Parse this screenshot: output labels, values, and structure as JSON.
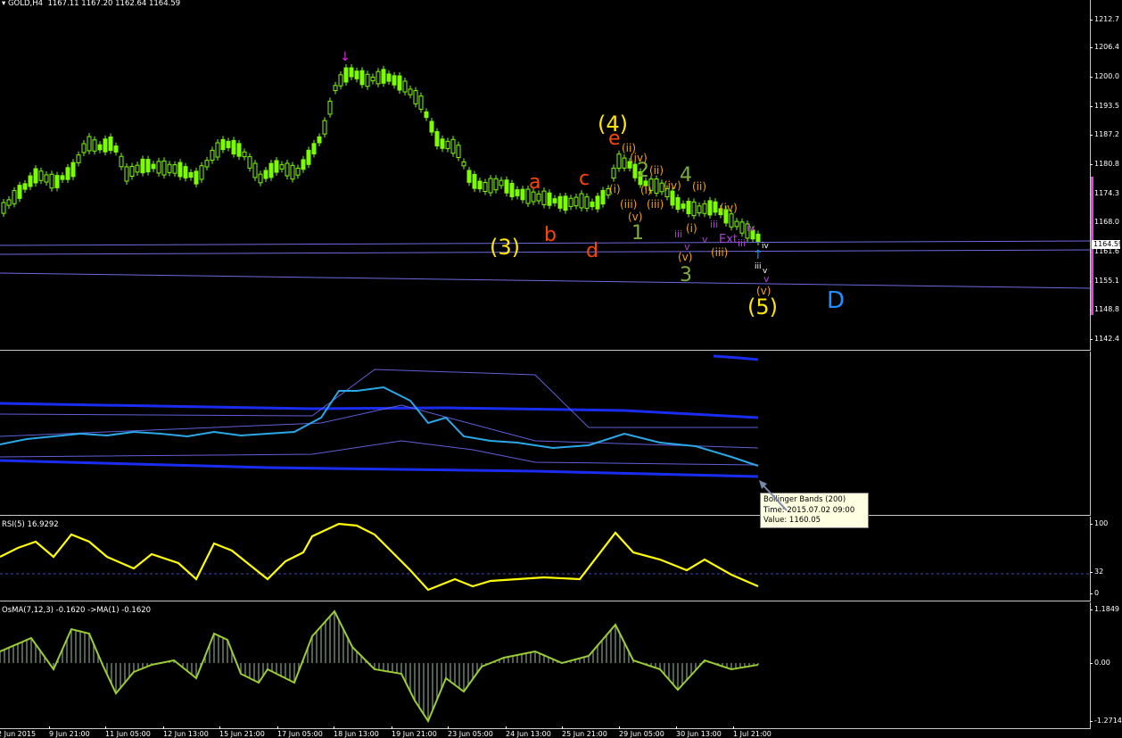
{
  "symbol": "GOLD,H4",
  "ohlc": "1167.11 1167.20 1162.64 1164.59",
  "current_price": "1164.59",
  "price_axis_ticks": [
    "1212.7",
    "1206.4",
    "1200.0",
    "1193.5",
    "1187.2",
    "1180.8",
    "1174.3",
    "1168.0",
    "1161.6",
    "1155.1",
    "1148.8",
    "1142.4"
  ],
  "bb_indicator": {
    "name": "Bollinger Bands (200)"
  },
  "rsi": {
    "label": "RSI(5) 16.9292",
    "ticks": [
      "100",
      "32",
      "0"
    ]
  },
  "osma": {
    "label": "OsMA(7,12,3) -0.1620  ->MA(1) -0.1620",
    "ticks": [
      "1.1849",
      "0.00",
      "-1.2714"
    ]
  },
  "time_axis": [
    "2 Jun 2015",
    "9 Jun 21:00",
    "11 Jun 05:00",
    "12 Jun 13:00",
    "15 Jun 21:00",
    "17 Jun 05:00",
    "18 Jun 13:00",
    "19 Jun 21:00",
    "23 Jun 05:00",
    "24 Jun 13:00",
    "25 Jun 21:00",
    "29 Jun 05:00",
    "30 Jun 13:00",
    "1 Jul 21:00"
  ],
  "tooltip": {
    "line1": "Bollinger Bands (200)",
    "line2": "Time: 2015.07.02 09:00",
    "line3": "Value: 1160.05"
  },
  "wave_labels": {
    "w4": "(4)",
    "w3": "(3)",
    "w5": "(5)",
    "a": "a",
    "b": "b",
    "c": "c",
    "d": "d",
    "e": "e",
    "one": "1",
    "two": "2",
    "three": "3",
    "four": "4",
    "D": "D",
    "ii": "(ii)",
    "iv": "(iv)",
    "i": "(i)",
    "iii": "(iii)",
    "v": "(v)",
    "ii2": "(ii)",
    "i2": "(i)",
    "iii2": "(iii)",
    "iv2": "(iv)",
    "v2": "(v)",
    "ii3": "(ii)",
    "i3": "(i)",
    "iii3": "(iii)",
    "iv3": "(iv)",
    "v3": "(v)",
    "r_iii": "iii",
    "r_v": "v",
    "r_iv": "iv",
    "r_Ext": "Ext",
    "r_v2": "v",
    "r_iii2": "iii",
    "r_iv2": "iv",
    "r_iii3": "iii",
    "r_v3": "v",
    "r_iv3": "iv"
  },
  "colors": {
    "candle": "#7cfc00",
    "wave_yellow": "#ffe600",
    "wave_red": "#ff4500",
    "wave_orange": "#f4a300",
    "wave_green": "#7cae3a",
    "wave_blue": "#1e90ff",
    "wave_magenta": "#b03fd8",
    "bb_thick": "#1a2cf0",
    "bb_thin": "#5a5ad8",
    "rsi": "#ffff00",
    "osma": "#9acd32"
  }
}
